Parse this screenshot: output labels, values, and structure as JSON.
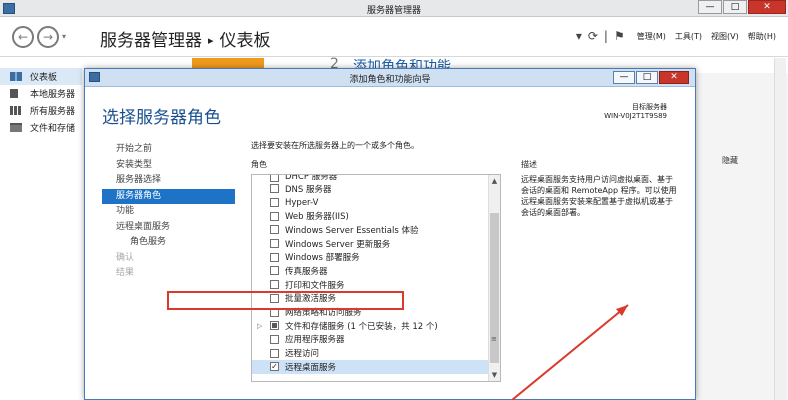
{
  "window": {
    "title": "服务器管理器",
    "buttons": {
      "minimize": "—",
      "maximize": "□",
      "close": "✕"
    }
  },
  "header": {
    "breadcrumb_root": "服务器管理器",
    "breadcrumb_sep": "▸",
    "breadcrumb_current": "仪表板",
    "back_icon": "←",
    "forward_icon": "→",
    "nav_dropdown": "▾",
    "refresh_dropdown": "▾",
    "refresh_icon": "⟳",
    "divider": "|",
    "flag_icon": "⚑",
    "menus": [
      "管理(M)",
      "工具(T)",
      "视图(V)",
      "帮助(H)"
    ]
  },
  "sidebar": {
    "items": [
      {
        "label": "仪表板",
        "icon": "dashboard-icon",
        "active": true
      },
      {
        "label": "本地服务器",
        "icon": "local-server-icon"
      },
      {
        "label": "所有服务器",
        "icon": "all-servers-icon"
      },
      {
        "label": "文件和存储",
        "icon": "file-storage-icon"
      }
    ]
  },
  "background": {
    "step_number": "2",
    "step_text": "添加角色和功能",
    "hide_label": "隐藏"
  },
  "wizard": {
    "title": "添加角色和功能向导",
    "buttons": {
      "minimize": "—",
      "maximize": "□",
      "close": "✕"
    },
    "heading": "选择服务器角色",
    "target_label": "目标服务器",
    "target_server": "WIN-V0J2T1T9S89",
    "instruction": "选择要安装在所选服务器上的一个或多个角色。",
    "roles_heading": "角色",
    "description_heading": "描述",
    "description_text": "远程桌面服务支持用户访问虚拟桌面、基于会话的桌面和 RemoteApp 程序。可以使用远程桌面服务安装来配置基于虚拟机或基于会话的桌面部署。",
    "steps": [
      {
        "label": "开始之前",
        "state": "normal"
      },
      {
        "label": "安装类型",
        "state": "normal"
      },
      {
        "label": "服务器选择",
        "state": "normal"
      },
      {
        "label": "服务器角色",
        "state": "active"
      },
      {
        "label": "功能",
        "state": "normal"
      },
      {
        "label": "远程桌面服务",
        "state": "normal"
      },
      {
        "label": "角色服务",
        "state": "normal",
        "sub": true
      },
      {
        "label": "确认",
        "state": "disabled"
      },
      {
        "label": "结果",
        "state": "disabled"
      }
    ],
    "roles": [
      {
        "label": "DHCP 服务器",
        "checked": false,
        "cut": true
      },
      {
        "label": "DNS 服务器",
        "checked": false
      },
      {
        "label": "Hyper-V",
        "checked": false
      },
      {
        "label": "Web 服务器(IIS)",
        "checked": false
      },
      {
        "label": "Windows Server Essentials 体验",
        "checked": false
      },
      {
        "label": "Windows Server 更新服务",
        "checked": false
      },
      {
        "label": "Windows 部署服务",
        "checked": false
      },
      {
        "label": "传真服务器",
        "checked": false
      },
      {
        "label": "打印和文件服务",
        "checked": false
      },
      {
        "label": "批量激活服务",
        "checked": false
      },
      {
        "label": "网络策略和访问服务",
        "checked": false
      },
      {
        "label": "文件和存储服务 (1 个已安装，共 12 个)",
        "checked": "partial",
        "expandable": true
      },
      {
        "label": "应用程序服务器",
        "checked": false
      },
      {
        "label": "远程访问",
        "checked": false
      },
      {
        "label": "远程桌面服务",
        "checked": true,
        "selected": true
      }
    ],
    "scroll": {
      "up": "▲",
      "down": "▼",
      "grip": "≡"
    },
    "expander_icon": "▷",
    "check_mark": "✓"
  },
  "colors": {
    "accent": "#1e73c6",
    "heading": "#1a4f8f",
    "highlight": "#d93a2b",
    "orange_tile": "#f09a1c"
  }
}
